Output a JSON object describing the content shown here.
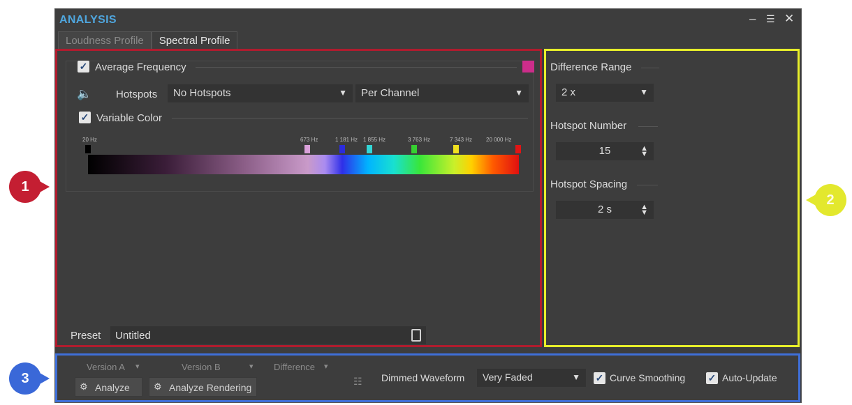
{
  "window": {
    "title": "ANALYSIS"
  },
  "tabs": [
    {
      "label": "Loudness Profile"
    },
    {
      "label": "Spectral Profile"
    }
  ],
  "callouts": [
    "1",
    "2",
    "3"
  ],
  "left": {
    "average_frequency": {
      "label": "Average Frequency",
      "checked": true,
      "swatch_color": "#cc2d8a"
    },
    "hotspots_label": "Hotspots",
    "hotspots_value": "No Hotspots",
    "channel_value": "Per Channel",
    "variable_color": {
      "label": "Variable Color",
      "checked": true
    },
    "frequency_markers": [
      "20 Hz",
      "673 Hz",
      "1 181 Hz",
      "1 855 Hz",
      "3 763 Hz",
      "7 343 Hz",
      "20 000 Hz"
    ],
    "marker_colors": [
      "#000000",
      "#d9a0d9",
      "#2b2bdd",
      "#33d6d6",
      "#36d030",
      "#f0e020",
      "#e01515"
    ],
    "preset_label": "Preset",
    "preset_value": "Untitled"
  },
  "right": {
    "difference_range": {
      "label": "Difference Range",
      "value": "2 x"
    },
    "hotspot_number": {
      "label": "Hotspot Number",
      "value": "15"
    },
    "hotspot_spacing": {
      "label": "Hotspot Spacing",
      "value": "2 s"
    }
  },
  "bottom": {
    "version_a": "Version A",
    "version_b": "Version B",
    "difference": "Difference",
    "analyze": "Analyze",
    "analyze_rendering": "Analyze Rendering",
    "dimmed_label": "Dimmed Waveform",
    "dimmed_value": "Very Faded",
    "curve_smoothing": {
      "label": "Curve Smoothing",
      "checked": true
    },
    "auto_update": {
      "label": "Auto-Update",
      "checked": true
    }
  },
  "colors": {
    "title": "#4fa6de",
    "red_highlight": "#b01c2e",
    "yellow_highlight": "#e8ef2a",
    "blue_highlight": "#3f6fd8"
  }
}
